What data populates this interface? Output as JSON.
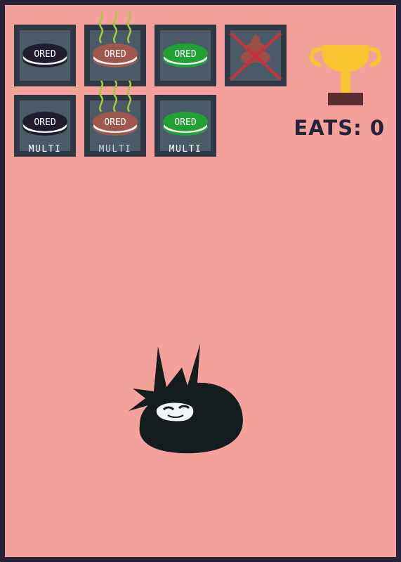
{
  "cookie_label": "ORED",
  "multi_label": "MULTI",
  "hud": {
    "eats_label": "EATS:",
    "eats_count": "0"
  },
  "slots": [
    {
      "kind": "oreo",
      "flavor": "dark",
      "stinky": false,
      "multi": false
    },
    {
      "kind": "oreo",
      "flavor": "rotten",
      "stinky": true,
      "multi": false
    },
    {
      "kind": "oreo",
      "flavor": "green",
      "stinky": false,
      "multi": false
    },
    {
      "kind": "poop",
      "crossed": true
    },
    {
      "kind": "oreo",
      "flavor": "dark",
      "stinky": false,
      "multi": true
    },
    {
      "kind": "oreo",
      "flavor": "rotten",
      "stinky": true,
      "multi": true
    },
    {
      "kind": "oreo",
      "flavor": "green",
      "stinky": false,
      "multi": true
    }
  ],
  "colors": {
    "background": "#f4a19b",
    "border": "#24233a",
    "slot": "#2f3945",
    "dark_cookie": "#1f1d2e",
    "rotten_cookie": "#a0584e",
    "green_cookie": "#22a035",
    "stink": "#a8c93a",
    "trophy": "#f7c531",
    "trophy_base": "#5a2e2e"
  }
}
